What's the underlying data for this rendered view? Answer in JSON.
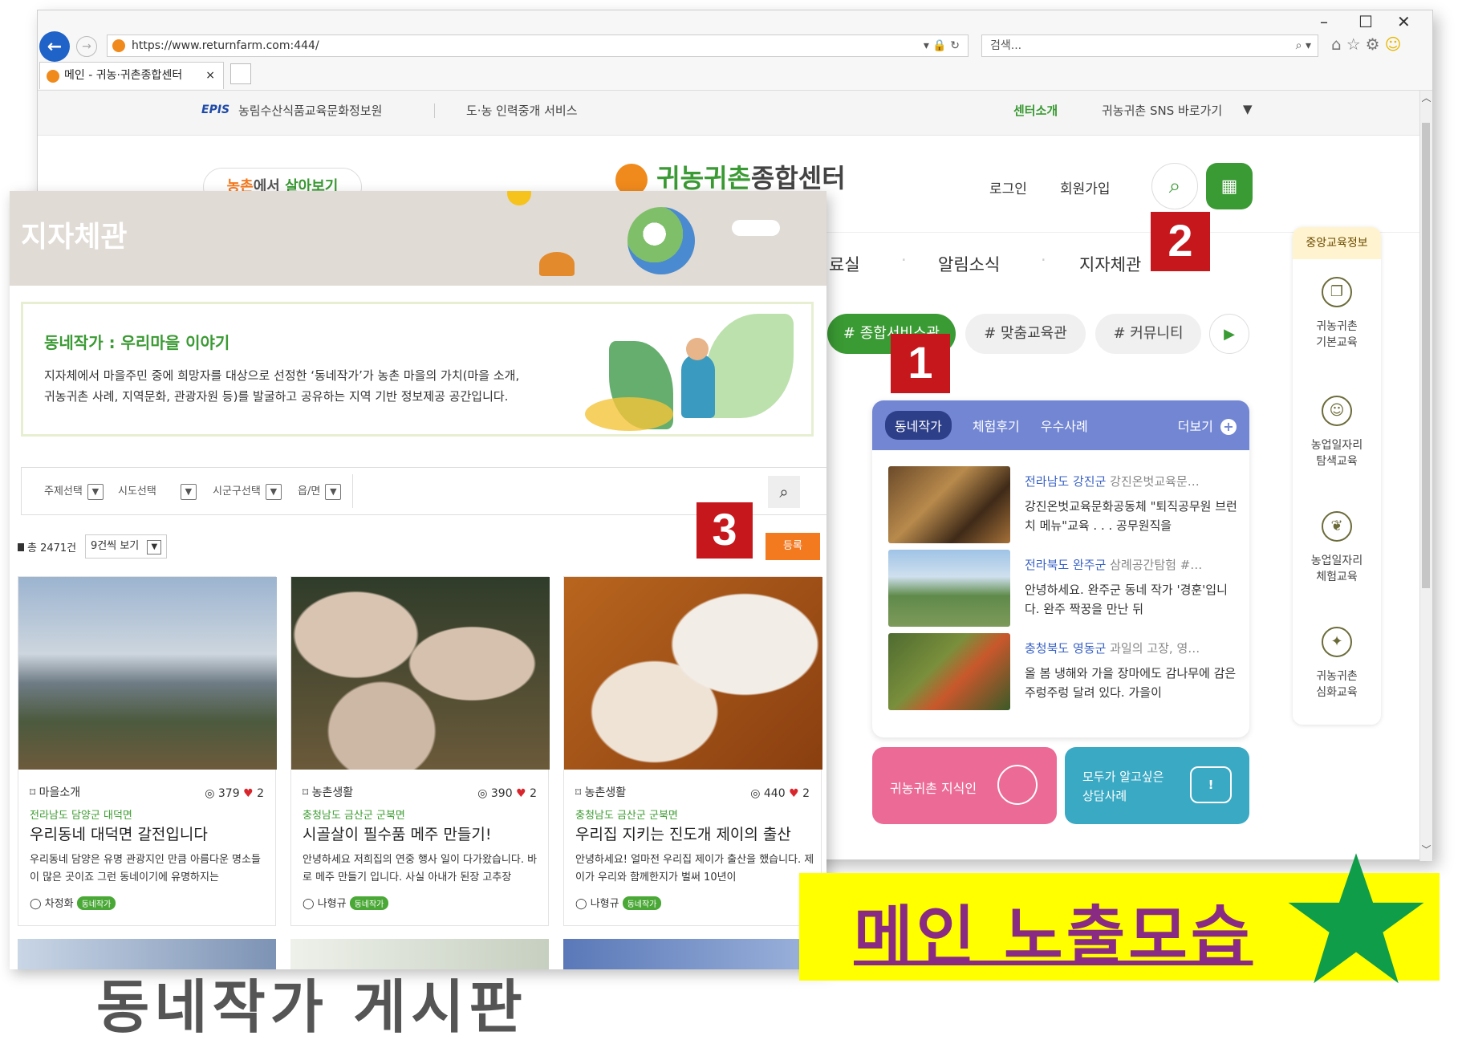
{
  "browser": {
    "url": "https://www.returnfarm.com:444/",
    "search_placeholder": "검색...",
    "tab_title": "메인 - 귀농·귀촌종합센터",
    "tab_close": "×",
    "min": "–",
    "max": "☐",
    "close": "✕"
  },
  "site": {
    "util_left1": "농림수산식품교육문화정보원",
    "util_left1_logo": "EPIS",
    "util_left2": "도·농 인력중개 서비스",
    "util_right1": "센터소개",
    "util_right2": "귀농귀촌 SNS 바로가기",
    "living_btn_a": "농촌",
    "living_btn_b": "에서 ",
    "living_btn_c": "살아보기",
    "logo_a": "귀농귀촌",
    "logo_b": "종합센터",
    "login": "로그인",
    "join": "회원가입",
    "gnb": [
      "료실",
      "알림소식",
      "지자체관"
    ],
    "hash1": "# 종합서비스관",
    "hash2": "# 맞춤교육관",
    "hash3": "# 커뮤니티",
    "news_tabs": [
      "동네작가",
      "체험후기",
      "우수사례"
    ],
    "news_more": "더보기",
    "news": [
      {
        "region": "전라남도 강진군",
        "sub": "강진온벗교육문…",
        "text": "강진온벗교육문화공동체 \"퇴직공무원 브런치 메뉴\"교육 . . . 공무원직을"
      },
      {
        "region": "전라북도 완주군",
        "sub": "삼례공간탐험 #…",
        "text": "안녕하세요. 완주군 동네 작가 '경훈'입니다. 완주 짝꿍을 만난 뒤"
      },
      {
        "region": "충청북도 영동군",
        "sub": "과일의 고장, 영…",
        "text": "올 봄 냉해와 가을 장마에도 감나무에 감은 주렁주렁 달려 있다. 가을이"
      }
    ],
    "pink_box": "귀농귀촌 지식인",
    "teal_box_1": "모두가 알고싶은",
    "teal_box_2": "상담사례",
    "quick_title": "중앙교육정보",
    "quick": [
      {
        "l1": "귀농귀촌",
        "l2": "기본교육"
      },
      {
        "l1": "농업일자리",
        "l2": "탐색교육"
      },
      {
        "l1": "농업일자리",
        "l2": "체험교육"
      },
      {
        "l1": "귀농귀촌",
        "l2": "심화교육"
      }
    ]
  },
  "labels": {
    "n1": "1",
    "n2": "2",
    "n3": "3"
  },
  "panel": {
    "banner_title": "지자체관",
    "intro_title": "동네작가 : 우리마을 이야기",
    "intro_line1": "지자체에서 마을주민 중에 희망자를 대상으로 선정한 ‘동네작가’가 농촌 마을의 가치(마을 소개,",
    "intro_line2": "귀농귀촌 사례, 지역문화, 관광자원 등)를 발굴하고 공유하는 지역 기반 정보제공 공간입니다.",
    "filters": [
      "주제선택",
      "시도선택",
      "시군구선택",
      "읍/면"
    ],
    "total": "총 2471건",
    "per_page": "9건씩 보기",
    "register": "등록",
    "cards": [
      {
        "tag": "마을소개",
        "views": "379",
        "likes": "2",
        "region": "전라남도 담양군 대덕면",
        "title": "우리동네 대덕면 갈전입니다",
        "desc": "우리동네 담양은 유명 관광지인 만큼 아름다운 명소들이 많은 곳이죠 그런 동네이기에 유명하지는",
        "author": "차정화",
        "badge": "동네작가"
      },
      {
        "tag": "농촌생활",
        "views": "390",
        "likes": "2",
        "region": "충청남도 금산군 군북면",
        "title": "시골살이 필수품 메주 만들기!",
        "desc": "안녕하세요 저희집의 연중 행사 일이 다가왔습니다. 바로 메주 만들기 입니다. 사실 아내가 된장 고추장",
        "author": "나형규",
        "badge": "동네작가"
      },
      {
        "tag": "농촌생활",
        "views": "440",
        "likes": "2",
        "region": "충청남도 금산군 군북면",
        "title": "우리집 지키는 진도개 제이의 출산",
        "desc": "안녕하세요! 얼마전 우리집 제이가 출산을 했습니다. 제이가 우리와 함께한지가 벌써 10년이",
        "author": "나형규",
        "badge": "동네작가"
      }
    ]
  },
  "caption": {
    "main": "메인 노출모습",
    "bottom": "동네작가 게시판"
  },
  "colors": {
    "green": "#3a9a33",
    "red": "#c6171c",
    "yellow": "#ffff00",
    "purple": "#8a2b83",
    "orange": "#f47a20",
    "blue": "#7286d3"
  }
}
